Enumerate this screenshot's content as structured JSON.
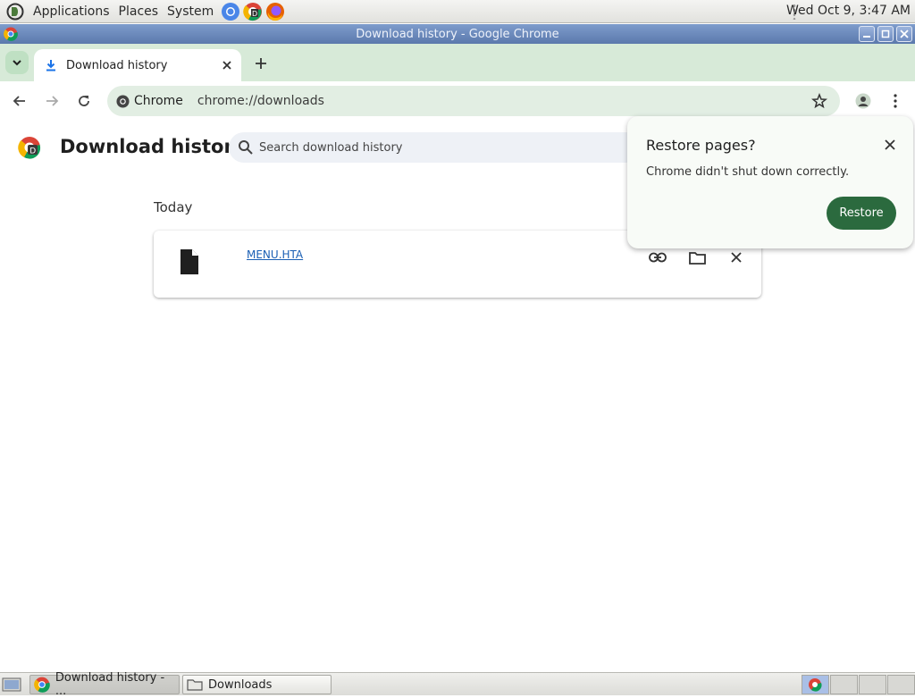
{
  "top_panel": {
    "menus": [
      "Applications",
      "Places",
      "System"
    ],
    "clock": "Wed Oct  9,  3:47 AM"
  },
  "window": {
    "title": "Download history - Google Chrome"
  },
  "tab": {
    "title": "Download history"
  },
  "omnibox": {
    "chip_label": "Chrome",
    "url": "chrome://downloads"
  },
  "page": {
    "title": "Download history",
    "search_placeholder": "Search download history",
    "date_group": "Today",
    "downloads": [
      {
        "filename": "MENU.HTA"
      }
    ]
  },
  "restore_popup": {
    "title": "Restore pages?",
    "message": "Chrome didn't shut down correctly.",
    "button_label": "Restore"
  },
  "taskbar": {
    "tasks": [
      "Download history - ...",
      "Downloads"
    ]
  },
  "colors": {
    "accent_green": "#2b6a3e",
    "tabstrip_bg": "#d7ead8",
    "titlebar_blue": "#5b79ac",
    "link_blue": "#1a5fb4"
  }
}
